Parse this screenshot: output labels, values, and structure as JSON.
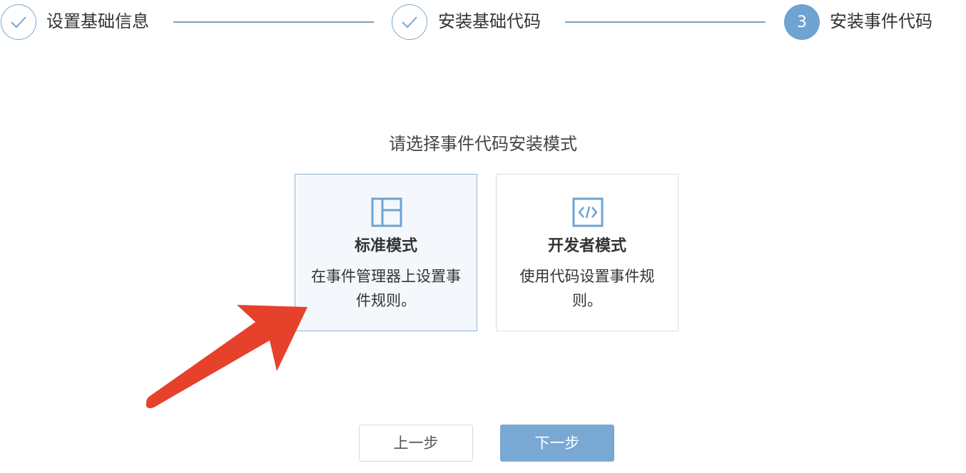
{
  "stepper": {
    "steps": [
      {
        "label": "设置基础信息",
        "state": "done"
      },
      {
        "label": "安装基础代码",
        "state": "done"
      },
      {
        "number": "3",
        "label": "安装事件代码",
        "state": "active"
      }
    ]
  },
  "main": {
    "prompt": "请选择事件代码安装模式",
    "options": [
      {
        "title": "标准模式",
        "description": "在事件管理器上设置事件规则。",
        "icon": "layout-panel-icon",
        "selected": true
      },
      {
        "title": "开发者模式",
        "description": "使用代码设置事件规则。",
        "icon": "code-icon",
        "selected": false
      }
    ]
  },
  "footer": {
    "prev_label": "上一步",
    "next_label": "下一步"
  },
  "colors": {
    "accent": "#6fa3d1",
    "selected_bg": "#f4f8fd",
    "arrow": "#e5412b"
  }
}
